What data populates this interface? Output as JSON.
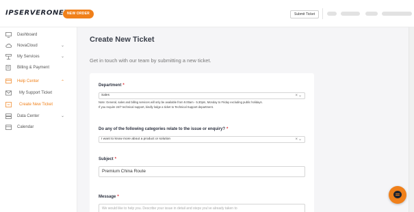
{
  "header": {
    "logo_text": "IPSERVERONE",
    "logo_mark": "™",
    "new_order_label": "NEW ORDER",
    "submit_ticket_label": "Submit Ticket"
  },
  "sidebar": {
    "items": [
      {
        "label": "Dashboard",
        "icon": "monitor-icon"
      },
      {
        "label": "NovaCloud",
        "icon": "cloud-icon",
        "expandable": true
      },
      {
        "label": "My Services",
        "icon": "services-icon",
        "expandable": true
      },
      {
        "label": "Billing & Payment",
        "icon": "billing-icon"
      },
      {
        "label": "Help Center",
        "icon": "help-icon",
        "expandable": true,
        "expanded": true,
        "active": true
      },
      {
        "label": "My Support Ticket",
        "icon": "envelope-icon",
        "sub": true
      },
      {
        "label": "Create New Ticket",
        "icon": "new-ticket-icon",
        "sub": true,
        "active": true
      },
      {
        "label": "Data Center",
        "icon": "server-icon",
        "expandable": true
      },
      {
        "label": "Calendar",
        "icon": "calendar-icon"
      }
    ]
  },
  "main": {
    "title": "Create New Ticket",
    "subtitle": "Get in touch with our team by submitting a new ticket.",
    "form": {
      "department": {
        "label": "Department",
        "required_mark": "*",
        "value": "Sales",
        "note_line1": "Note: General, sales and billing services will only be available from 9.00am - 5.30pm, Monday to Friday excluding public holidays.",
        "note_line2": "If you require 24/7 technical support, kindly lodge a ticket to Technical Support department."
      },
      "category": {
        "label": "Do any of the following categories relate to the issue or enquiry?",
        "required_mark": "*",
        "value": "I want to know more about a product or solution"
      },
      "subject": {
        "label": "Subject",
        "required_mark": "*",
        "value": "Premium China Route"
      },
      "message": {
        "label": "Message",
        "required_mark": "*",
        "placeholder": "We would like to help you. Describe your issue in detail and steps you've already taken to"
      }
    }
  },
  "colors": {
    "accent": "#f0801a",
    "required": "#e0262e",
    "dark": "#1f2430"
  }
}
